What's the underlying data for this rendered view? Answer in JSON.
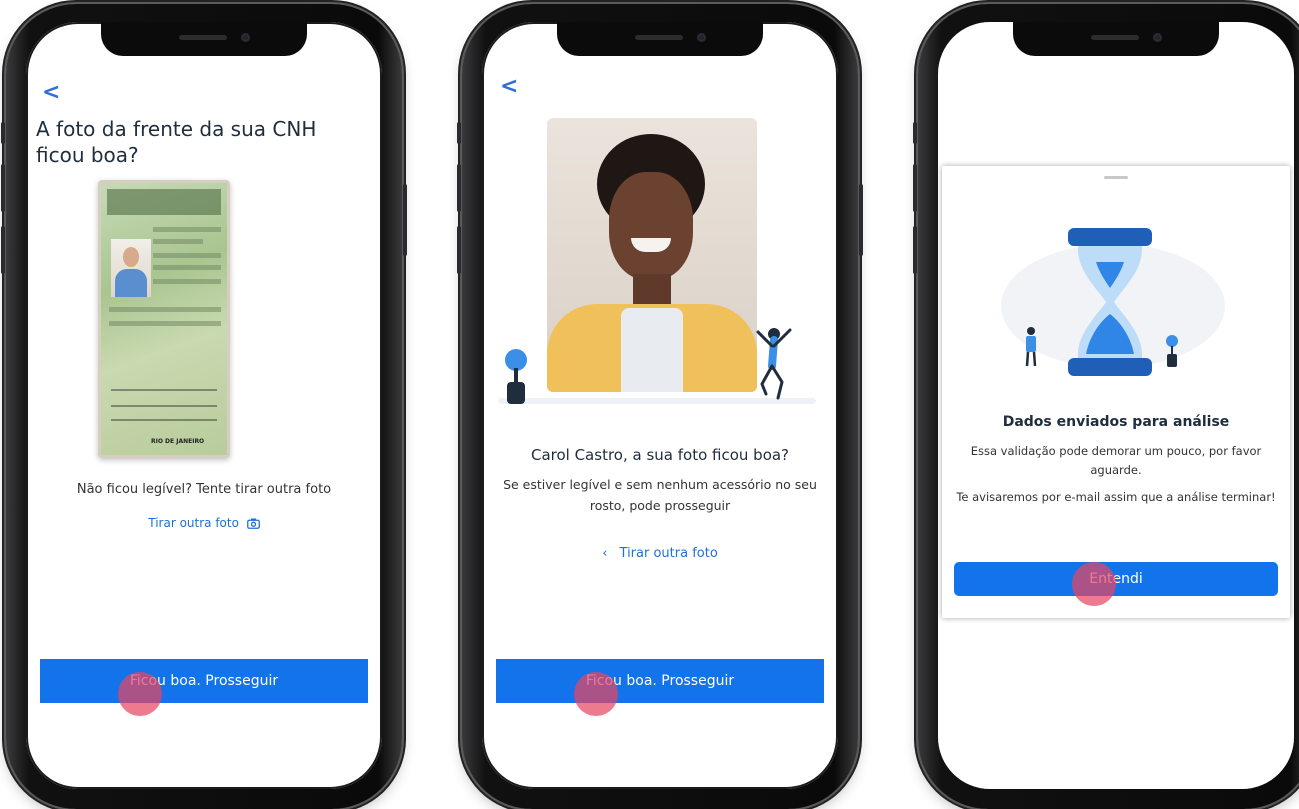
{
  "screens": [
    {
      "back_label": "<",
      "title": "A foto da frente da sua CNH ficou boa?",
      "license_city": "RIO DE JANEIRO",
      "hint": "Não ficou legível? Tente tirar outra foto",
      "retake_link": "Tirar outra foto",
      "retake_icon": "camera-icon",
      "cta_label": "Ficou boa. Prosseguir"
    },
    {
      "back_label": "<",
      "title": "Carol Castro, a sua foto ficou boa?",
      "body": "Se estiver legível e sem nenhum acessório no seu rosto, pode prosseguir",
      "retake_link": "Tirar outra foto",
      "retake_icon": "chevron-left-icon",
      "cta_label": "Ficou boa. Prosseguir"
    },
    {
      "modal_title": "Dados enviados para análise",
      "modal_text_1": "Essa validação pode demorar um pouco, por favor aguarde.",
      "modal_text_2": "Te avisaremos por e-mail assim que a análise terminar!",
      "cta_label": "Entendi"
    }
  ],
  "colors": {
    "primary": "#1273ea",
    "link": "#1e6fd9",
    "title": "#1f2d3d",
    "tap_indicator": "#e64664"
  }
}
